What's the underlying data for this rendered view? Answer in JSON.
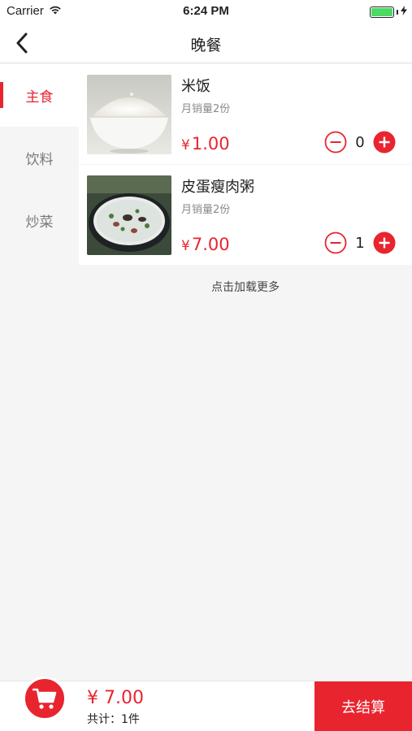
{
  "status_bar": {
    "carrier": "Carrier",
    "time": "6:24 PM"
  },
  "nav": {
    "title": "晚餐",
    "back_icon": "chevron-left-icon"
  },
  "categories": [
    {
      "label": "主食",
      "active": true
    },
    {
      "label": "饮料",
      "active": false
    },
    {
      "label": "炒菜",
      "active": false
    }
  ],
  "products": [
    {
      "name": "米饭",
      "sales": "月销量2份",
      "currency": "¥",
      "price": "1.00",
      "qty": "0",
      "image": "bowl-of-rice"
    },
    {
      "name": "皮蛋瘦肉粥",
      "sales": "月销量2份",
      "currency": "¥",
      "price": "7.00",
      "qty": "1",
      "image": "congee-bowl"
    }
  ],
  "load_more": "点击加载更多",
  "cart": {
    "currency": "¥",
    "total": "7.00",
    "count_text": "共计：1件",
    "checkout_label": "去结算"
  },
  "colors": {
    "accent": "#e8242f",
    "battery": "#4cd964"
  }
}
